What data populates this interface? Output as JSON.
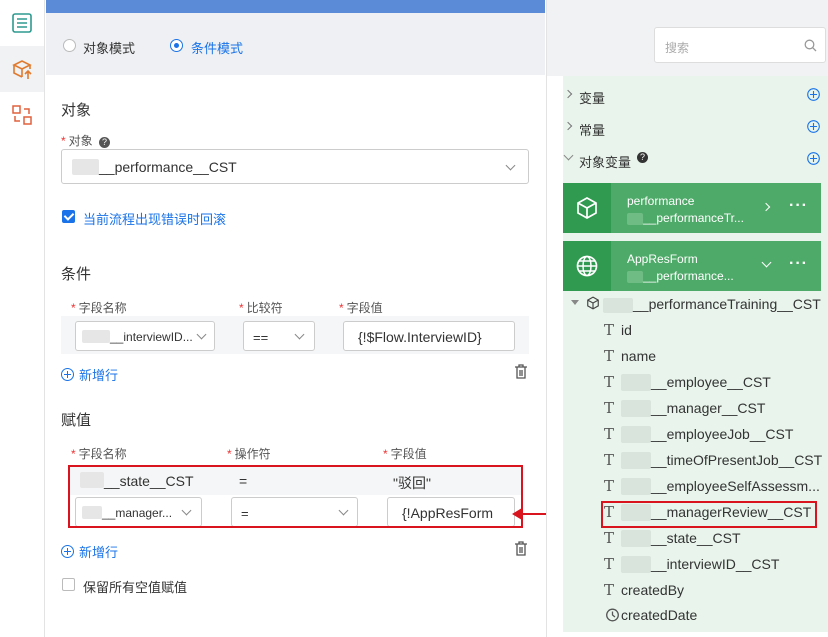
{
  "mode": {
    "object_label": "对象模式",
    "condition_label": "条件模式",
    "selected": "条件模式"
  },
  "object_section": {
    "title": "对象",
    "field_label": "对象",
    "help": "?",
    "select_value": "__performance__CST"
  },
  "rollback": {
    "label": "当前流程出现错误时回滚",
    "checked": true
  },
  "conditions": {
    "title": "条件",
    "col_name": "字段名称",
    "col_cmp": "比较符",
    "col_value": "字段值",
    "row": {
      "name": "__interviewID...",
      "cmp": "==",
      "value": "{!$Flow.InterviewID}"
    },
    "add_row": "新增行"
  },
  "assign": {
    "title": "赋值",
    "col_name": "字段名称",
    "col_op": "操作符",
    "col_value": "字段值",
    "row1": {
      "name": "__state__CST",
      "op": "=",
      "value": "\"驳回\""
    },
    "row2": {
      "name": "__manager...",
      "op": "=",
      "value": "{!AppResForm"
    },
    "add_row": "新增行"
  },
  "keep_null": {
    "label": "保留所有空值赋值",
    "checked": false
  },
  "right": {
    "search_placeholder": "搜索",
    "variables": "变量",
    "constants": "常量",
    "object_variables": "对象变量",
    "help": "?",
    "card1": {
      "title": "performance",
      "subtitle": "__performanceTr..."
    },
    "card2": {
      "title": "AppResForm",
      "subtitle": "__performance..."
    },
    "tree_root": "__performanceTraining__CST",
    "fields": [
      {
        "name": "id",
        "type": "T"
      },
      {
        "name": "name",
        "type": "T"
      },
      {
        "name": "__employee__CST",
        "type": "T"
      },
      {
        "name": "__manager__CST",
        "type": "T"
      },
      {
        "name": "__employeeJob__CST",
        "type": "T"
      },
      {
        "name": "__timeOfPresentJob__CST",
        "type": "T"
      },
      {
        "name": "__employeeSelfAssessm...",
        "type": "T"
      },
      {
        "name": "__managerReview__CST",
        "type": "T"
      },
      {
        "name": "__state__CST",
        "type": "T"
      },
      {
        "name": "__interviewID__CST",
        "type": "T"
      },
      {
        "name": "createdBy",
        "type": "T"
      },
      {
        "name": "createdDate",
        "type": "clock"
      }
    ]
  },
  "colors": {
    "primary": "#1a73e8",
    "green": "#4eaa68",
    "highlight": "#d9141e"
  }
}
